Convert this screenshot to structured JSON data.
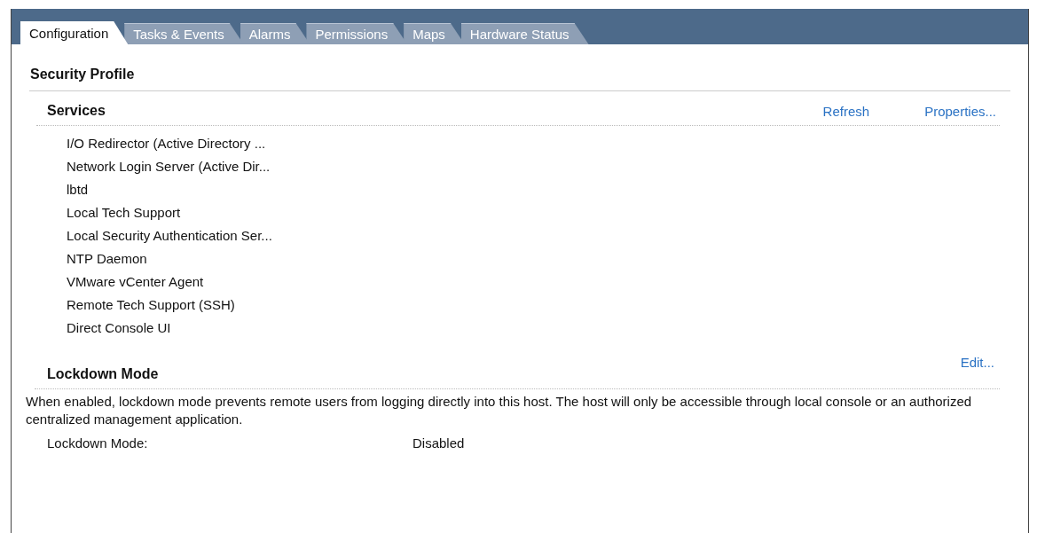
{
  "tabs": [
    {
      "label": "Configuration",
      "selected": true
    },
    {
      "label": "Tasks & Events",
      "selected": false
    },
    {
      "label": "Alarms",
      "selected": false
    },
    {
      "label": "Permissions",
      "selected": false
    },
    {
      "label": "Maps",
      "selected": false
    },
    {
      "label": "Hardware Status",
      "selected": false
    }
  ],
  "title": "Security Profile",
  "services": {
    "heading": "Services",
    "actions": [
      "Refresh",
      "Properties..."
    ],
    "items": [
      "I/O Redirector (Active Directory ...",
      "Network Login Server (Active Dir...",
      "lbtd",
      "Local Tech Support",
      "Local Security Authentication Ser...",
      "NTP Daemon",
      "VMware vCenter Agent",
      "Remote Tech Support (SSH)",
      "Direct Console UI"
    ]
  },
  "lockdown": {
    "heading": "Lockdown Mode",
    "action": "Edit...",
    "description": "When enabled, lockdown mode prevents remote users from logging directly into this host. The host will only be accessible through local console or an authorized centralized management application.",
    "label": "Lockdown Mode:",
    "value": "Disabled"
  }
}
